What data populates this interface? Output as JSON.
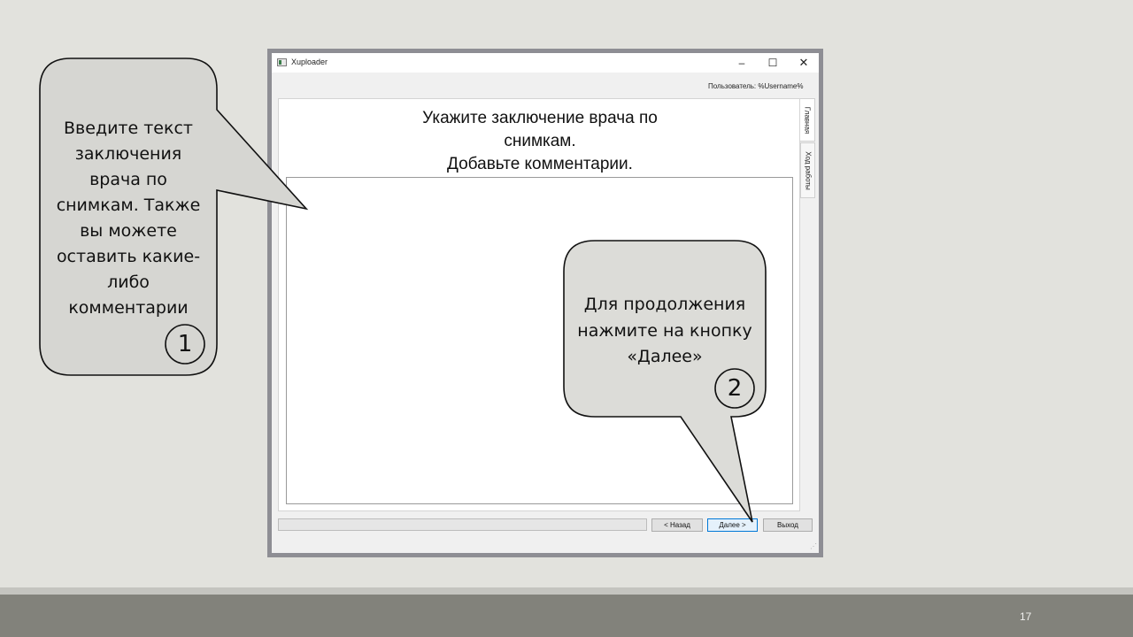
{
  "window": {
    "title": "Xuploader",
    "controls": {
      "minimize": "–",
      "maximize": "☐",
      "close": "✕"
    },
    "user_label": "Пользователь:  %Username%"
  },
  "panel": {
    "instruction_lines": [
      "Укажите заключение врача по",
      "снимкам.",
      "Добавьте комментарии."
    ],
    "conclusion_text": ""
  },
  "side_tabs": [
    {
      "label": "Главная",
      "active": true
    },
    {
      "label": "Ход работы",
      "active": false
    }
  ],
  "progress": {
    "value": 0
  },
  "buttons": {
    "back": "< Назад",
    "next": "Далее >",
    "exit": "Выход"
  },
  "callouts": [
    {
      "badge": "1",
      "lines": [
        "Введите текст",
        "заключения",
        "врача по",
        "снимкам. Также",
        "вы можете",
        "оставить какие-",
        "либо",
        "комментарии"
      ]
    },
    {
      "badge": "2",
      "lines": [
        "Для продолжения",
        "нажмите на кнопку",
        "«Далее»"
      ]
    }
  ],
  "slide_number": "17",
  "colors": {
    "accent": "#0078d7",
    "callout_fill": "#d6d6d2",
    "footer": "#82827b"
  }
}
